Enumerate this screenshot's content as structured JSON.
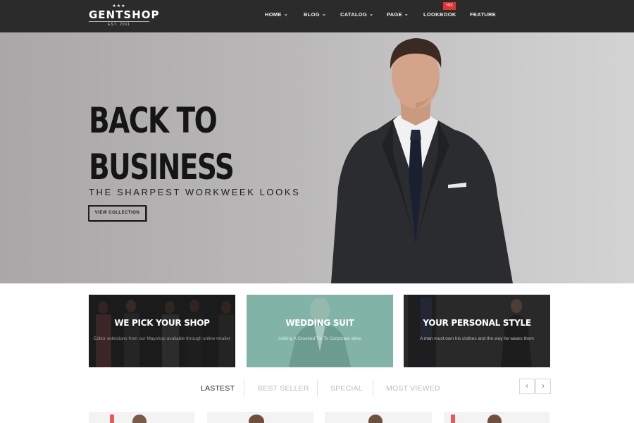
{
  "header": {
    "logo": {
      "stars": "★★★",
      "name": "GENTSHOP",
      "tagline": "EST. 2011"
    },
    "nav": [
      {
        "label": "HOME",
        "dropdown": true
      },
      {
        "label": "BLOG",
        "dropdown": true
      },
      {
        "label": "CATALOG",
        "dropdown": true
      },
      {
        "label": "PAGE",
        "dropdown": true
      },
      {
        "label": "LOOKBOOK",
        "dropdown": false,
        "badge": "Hot"
      },
      {
        "label": "FEATURE",
        "dropdown": false
      }
    ]
  },
  "hero": {
    "title_line1": "BACK TO",
    "title_line2": "BUSINESS",
    "subtitle": "THE SHARPEST WORKWEEK LOOKS",
    "button_label": "VIEW COLLECTION"
  },
  "banners": [
    {
      "title": "WE PICK YOUR SHOP",
      "description": "Editor selections from our Mayshop available through online retailer"
    },
    {
      "title": "WEDDING SUIT",
      "description": "Adding A Crooked Tie To Corporate attire"
    },
    {
      "title": "YOUR PERSONAL STYLE",
      "description": "A man must own his clothes and the way he wears them"
    }
  ],
  "tabs": [
    {
      "label": "LASTEST",
      "active": true
    },
    {
      "label": "BEST SELLER",
      "active": false
    },
    {
      "label": "SPECIAL",
      "active": false
    },
    {
      "label": "MOST VIEWED",
      "active": false
    }
  ],
  "carousel": {
    "prev_icon": "chevron-left-icon",
    "next_icon": "chevron-right-icon",
    "prev_glyph": "‹",
    "next_glyph": "›"
  },
  "colors": {
    "header_bg": "#2b2b2b",
    "hot_badge": "#e0332f",
    "accent_teal": "#7fb0a5",
    "text_dark": "#1e1e1e"
  }
}
